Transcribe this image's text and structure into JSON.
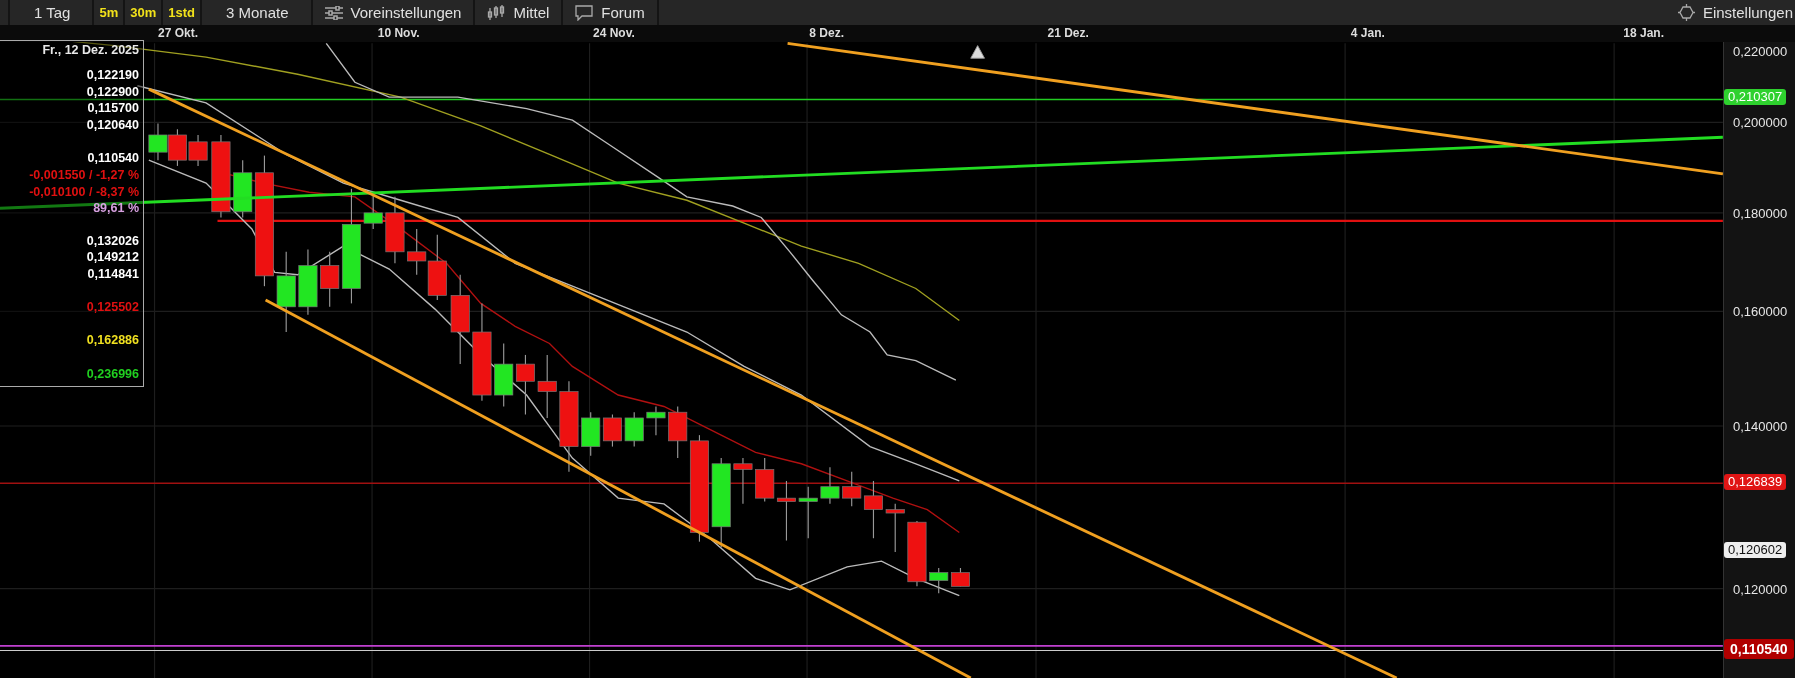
{
  "toolbar": {
    "items": [
      {
        "kind": "period",
        "label": "1 Tag"
      },
      {
        "kind": "interval",
        "label": "5m"
      },
      {
        "kind": "interval",
        "label": "30m"
      },
      {
        "kind": "interval",
        "label": "1std"
      },
      {
        "kind": "period",
        "label": "3 Monate"
      },
      {
        "kind": "presets",
        "label": "Voreinstellungen"
      },
      {
        "kind": "indicators",
        "label": "Mittel"
      },
      {
        "kind": "forum",
        "label": "Forum"
      }
    ],
    "settings": {
      "label": "Einstellungen"
    }
  },
  "x_axis": {
    "labels": [
      "27 Okt.",
      "10 Nov.",
      "24 Nov.",
      "8 Dez.",
      "21 Dez.",
      "4 Jan.",
      "18 Jan."
    ]
  },
  "y_axis": {
    "ticks": [
      "0,220000",
      "0,200000",
      "0,180000",
      "0,160000",
      "0,140000",
      "0,120000"
    ],
    "badges": [
      {
        "label": "0,210307",
        "color": "#2ed12e"
      },
      {
        "label": "0,126839",
        "color": "#e01515"
      },
      {
        "label": "0,120602",
        "color": "#eeeeee"
      },
      {
        "label": "0,110540",
        "color": "#b00000"
      }
    ]
  },
  "info_panel": {
    "date": "Fr., 12 Dez. 2025",
    "rows": [
      {
        "value": "0,122190",
        "color": "#ffffff"
      },
      {
        "value": "0,122900",
        "color": "#ffffff"
      },
      {
        "value": "0,115700",
        "color": "#ffffff"
      },
      {
        "value": "0,120640",
        "color": "#ffffff"
      },
      {
        "value": "0,110540",
        "color": "#ffffff"
      },
      {
        "value": "-0,001550 / -1,27 %",
        "color": "#e01010"
      },
      {
        "value": "-0,010100 / -8,37 %",
        "color": "#e01010"
      },
      {
        "value": "89,61 %",
        "color": "#d7a0e0"
      },
      {
        "value": "0,132026",
        "color": "#ffffff"
      },
      {
        "value": "0,149212",
        "color": "#ffffff"
      },
      {
        "value": "0,114841",
        "color": "#ffffff"
      },
      {
        "value": "0,125502",
        "color": "#e01010"
      },
      {
        "value": "0,162886",
        "color": "#f0e020"
      },
      {
        "value": "0,236996",
        "color": "#20d020"
      }
    ]
  }
}
